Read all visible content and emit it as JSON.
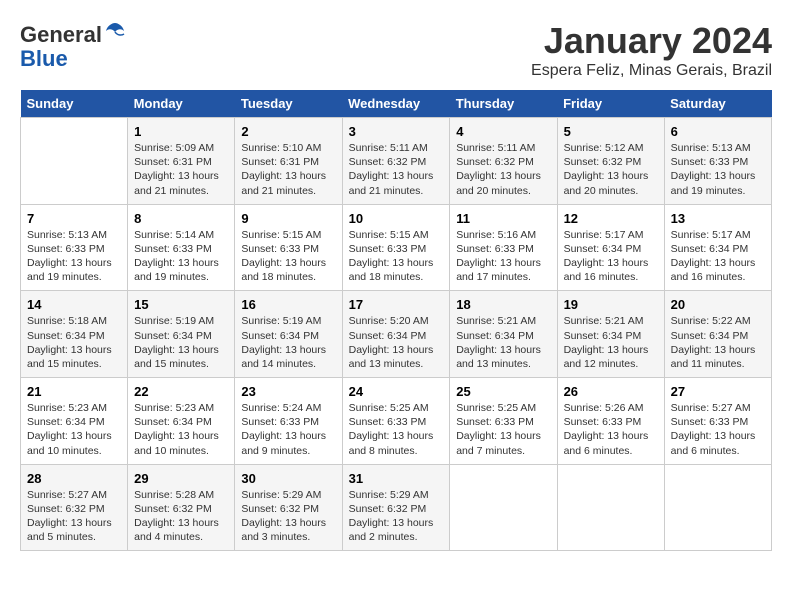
{
  "logo": {
    "general": "General",
    "blue": "Blue"
  },
  "header": {
    "month": "January 2024",
    "location": "Espera Feliz, Minas Gerais, Brazil"
  },
  "weekdays": [
    "Sunday",
    "Monday",
    "Tuesday",
    "Wednesday",
    "Thursday",
    "Friday",
    "Saturday"
  ],
  "weeks": [
    [
      {
        "day": "",
        "info": ""
      },
      {
        "day": "1",
        "info": "Sunrise: 5:09 AM\nSunset: 6:31 PM\nDaylight: 13 hours\nand 21 minutes."
      },
      {
        "day": "2",
        "info": "Sunrise: 5:10 AM\nSunset: 6:31 PM\nDaylight: 13 hours\nand 21 minutes."
      },
      {
        "day": "3",
        "info": "Sunrise: 5:11 AM\nSunset: 6:32 PM\nDaylight: 13 hours\nand 21 minutes."
      },
      {
        "day": "4",
        "info": "Sunrise: 5:11 AM\nSunset: 6:32 PM\nDaylight: 13 hours\nand 20 minutes."
      },
      {
        "day": "5",
        "info": "Sunrise: 5:12 AM\nSunset: 6:32 PM\nDaylight: 13 hours\nand 20 minutes."
      },
      {
        "day": "6",
        "info": "Sunrise: 5:13 AM\nSunset: 6:33 PM\nDaylight: 13 hours\nand 19 minutes."
      }
    ],
    [
      {
        "day": "7",
        "info": "Sunrise: 5:13 AM\nSunset: 6:33 PM\nDaylight: 13 hours\nand 19 minutes."
      },
      {
        "day": "8",
        "info": "Sunrise: 5:14 AM\nSunset: 6:33 PM\nDaylight: 13 hours\nand 19 minutes."
      },
      {
        "day": "9",
        "info": "Sunrise: 5:15 AM\nSunset: 6:33 PM\nDaylight: 13 hours\nand 18 minutes."
      },
      {
        "day": "10",
        "info": "Sunrise: 5:15 AM\nSunset: 6:33 PM\nDaylight: 13 hours\nand 18 minutes."
      },
      {
        "day": "11",
        "info": "Sunrise: 5:16 AM\nSunset: 6:33 PM\nDaylight: 13 hours\nand 17 minutes."
      },
      {
        "day": "12",
        "info": "Sunrise: 5:17 AM\nSunset: 6:34 PM\nDaylight: 13 hours\nand 16 minutes."
      },
      {
        "day": "13",
        "info": "Sunrise: 5:17 AM\nSunset: 6:34 PM\nDaylight: 13 hours\nand 16 minutes."
      }
    ],
    [
      {
        "day": "14",
        "info": "Sunrise: 5:18 AM\nSunset: 6:34 PM\nDaylight: 13 hours\nand 15 minutes."
      },
      {
        "day": "15",
        "info": "Sunrise: 5:19 AM\nSunset: 6:34 PM\nDaylight: 13 hours\nand 15 minutes."
      },
      {
        "day": "16",
        "info": "Sunrise: 5:19 AM\nSunset: 6:34 PM\nDaylight: 13 hours\nand 14 minutes."
      },
      {
        "day": "17",
        "info": "Sunrise: 5:20 AM\nSunset: 6:34 PM\nDaylight: 13 hours\nand 13 minutes."
      },
      {
        "day": "18",
        "info": "Sunrise: 5:21 AM\nSunset: 6:34 PM\nDaylight: 13 hours\nand 13 minutes."
      },
      {
        "day": "19",
        "info": "Sunrise: 5:21 AM\nSunset: 6:34 PM\nDaylight: 13 hours\nand 12 minutes."
      },
      {
        "day": "20",
        "info": "Sunrise: 5:22 AM\nSunset: 6:34 PM\nDaylight: 13 hours\nand 11 minutes."
      }
    ],
    [
      {
        "day": "21",
        "info": "Sunrise: 5:23 AM\nSunset: 6:34 PM\nDaylight: 13 hours\nand 10 minutes."
      },
      {
        "day": "22",
        "info": "Sunrise: 5:23 AM\nSunset: 6:34 PM\nDaylight: 13 hours\nand 10 minutes."
      },
      {
        "day": "23",
        "info": "Sunrise: 5:24 AM\nSunset: 6:33 PM\nDaylight: 13 hours\nand 9 minutes."
      },
      {
        "day": "24",
        "info": "Sunrise: 5:25 AM\nSunset: 6:33 PM\nDaylight: 13 hours\nand 8 minutes."
      },
      {
        "day": "25",
        "info": "Sunrise: 5:25 AM\nSunset: 6:33 PM\nDaylight: 13 hours\nand 7 minutes."
      },
      {
        "day": "26",
        "info": "Sunrise: 5:26 AM\nSunset: 6:33 PM\nDaylight: 13 hours\nand 6 minutes."
      },
      {
        "day": "27",
        "info": "Sunrise: 5:27 AM\nSunset: 6:33 PM\nDaylight: 13 hours\nand 6 minutes."
      }
    ],
    [
      {
        "day": "28",
        "info": "Sunrise: 5:27 AM\nSunset: 6:32 PM\nDaylight: 13 hours\nand 5 minutes."
      },
      {
        "day": "29",
        "info": "Sunrise: 5:28 AM\nSunset: 6:32 PM\nDaylight: 13 hours\nand 4 minutes."
      },
      {
        "day": "30",
        "info": "Sunrise: 5:29 AM\nSunset: 6:32 PM\nDaylight: 13 hours\nand 3 minutes."
      },
      {
        "day": "31",
        "info": "Sunrise: 5:29 AM\nSunset: 6:32 PM\nDaylight: 13 hours\nand 2 minutes."
      },
      {
        "day": "",
        "info": ""
      },
      {
        "day": "",
        "info": ""
      },
      {
        "day": "",
        "info": ""
      }
    ]
  ]
}
